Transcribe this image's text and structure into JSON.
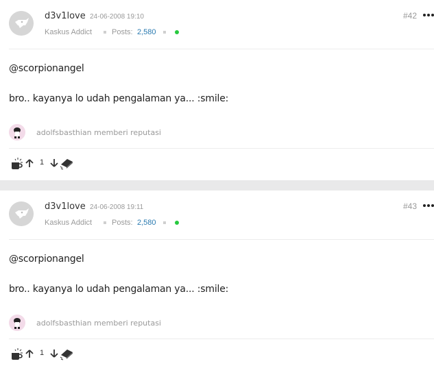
{
  "posts": [
    {
      "username": "d3v1love",
      "datetime": "24-06-2008 19:10",
      "rank": "Kaskus Addict",
      "posts_label": "Posts:",
      "posts_count": "2,580",
      "post_number": "#42",
      "mention": "@scorpionangel",
      "message": "bro.. kayanya lo udah pengalaman ya... :smile:",
      "reputation_text": "adolfsbasthian memberi reputasi",
      "vote_count": "1"
    },
    {
      "username": "d3v1love",
      "datetime": "24-06-2008 19:11",
      "rank": "Kaskus Addict",
      "posts_label": "Posts:",
      "posts_count": "2,580",
      "post_number": "#43",
      "mention": "@scorpionangel",
      "message": "bro.. kayanya lo udah pengalaman ya... :smile:",
      "reputation_text": "adolfsbasthian memberi reputasi",
      "vote_count": "1"
    }
  ],
  "icons": {
    "more": "more-dots-icon",
    "coffee": "coffee-cup-icon",
    "upvote": "arrow-up-icon",
    "downvote": "arrow-down-icon",
    "quote": "quote-icon"
  },
  "colors": {
    "online": "#27c93f",
    "posts_count": "#2a7ab0",
    "muted": "#999999",
    "separator": "#e9e9ea"
  }
}
